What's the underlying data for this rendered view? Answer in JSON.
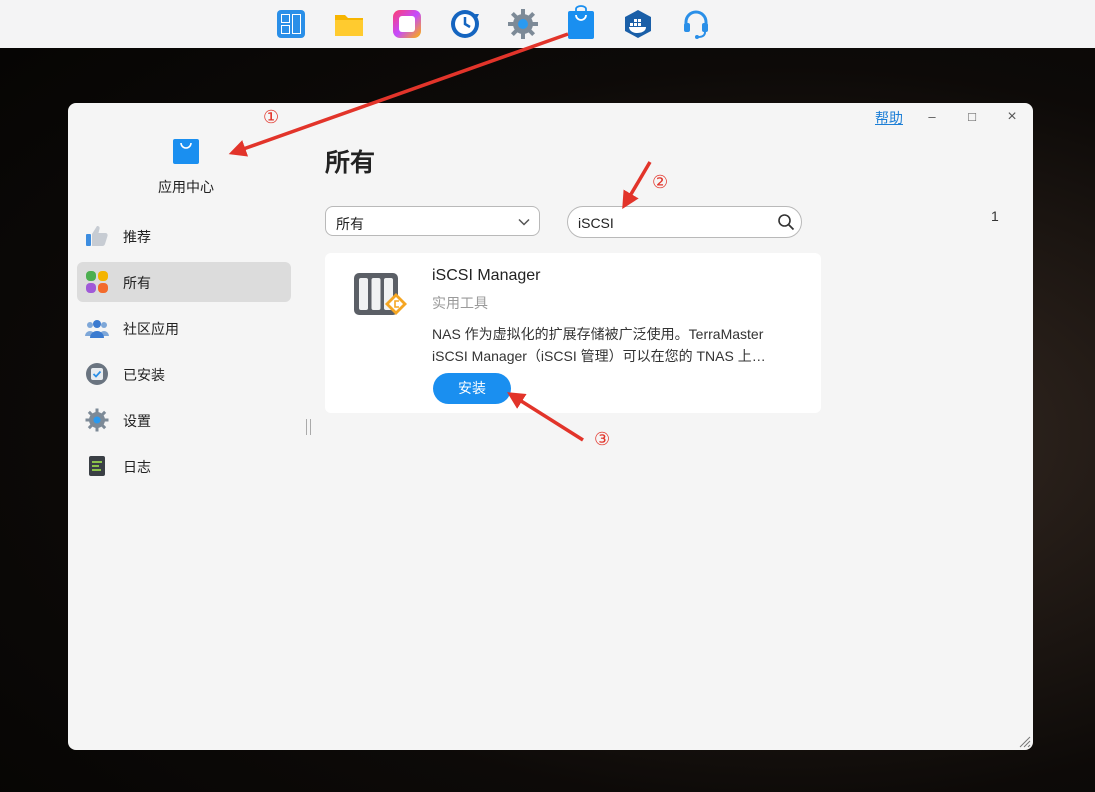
{
  "taskbar": {
    "icons": [
      "control-panel-icon",
      "file-manager-icon",
      "media-center-icon",
      "backup-icon",
      "settings-icon",
      "app-center-icon",
      "docker-icon",
      "support-icon"
    ]
  },
  "window": {
    "help_label": "帮助",
    "minimize_label": "–",
    "maximize_label": "□",
    "close_label": "×"
  },
  "sidebar": {
    "app_name": "应用中心",
    "items": [
      {
        "label": "推荐",
        "icon": "thumbs-up-icon"
      },
      {
        "label": "所有",
        "icon": "all-apps-icon",
        "active": true
      },
      {
        "label": "社区应用",
        "icon": "community-icon"
      },
      {
        "label": "已安装",
        "icon": "installed-icon"
      },
      {
        "label": "设置",
        "icon": "gear-icon"
      },
      {
        "label": "日志",
        "icon": "log-icon"
      }
    ]
  },
  "main": {
    "title": "所有",
    "filter": {
      "selected": "所有"
    },
    "search": {
      "value": "iSCSI"
    },
    "page_count": "1",
    "cards": [
      {
        "name": "iSCSI Manager",
        "category": "实用工具",
        "description_line1": "NAS 作为虚拟化的扩展存储被广泛使用。TerraMaster",
        "description_line2": "iSCSI Manager（iSCSI 管理）可以在您的 TNAS 上…",
        "button_label": "安装"
      }
    ]
  },
  "annotations": {
    "step1": "①",
    "step2": "②",
    "step3": "③",
    "color": "#e2342a"
  },
  "colors": {
    "accent": "#1a8ff0",
    "link": "#1d7fd6"
  }
}
